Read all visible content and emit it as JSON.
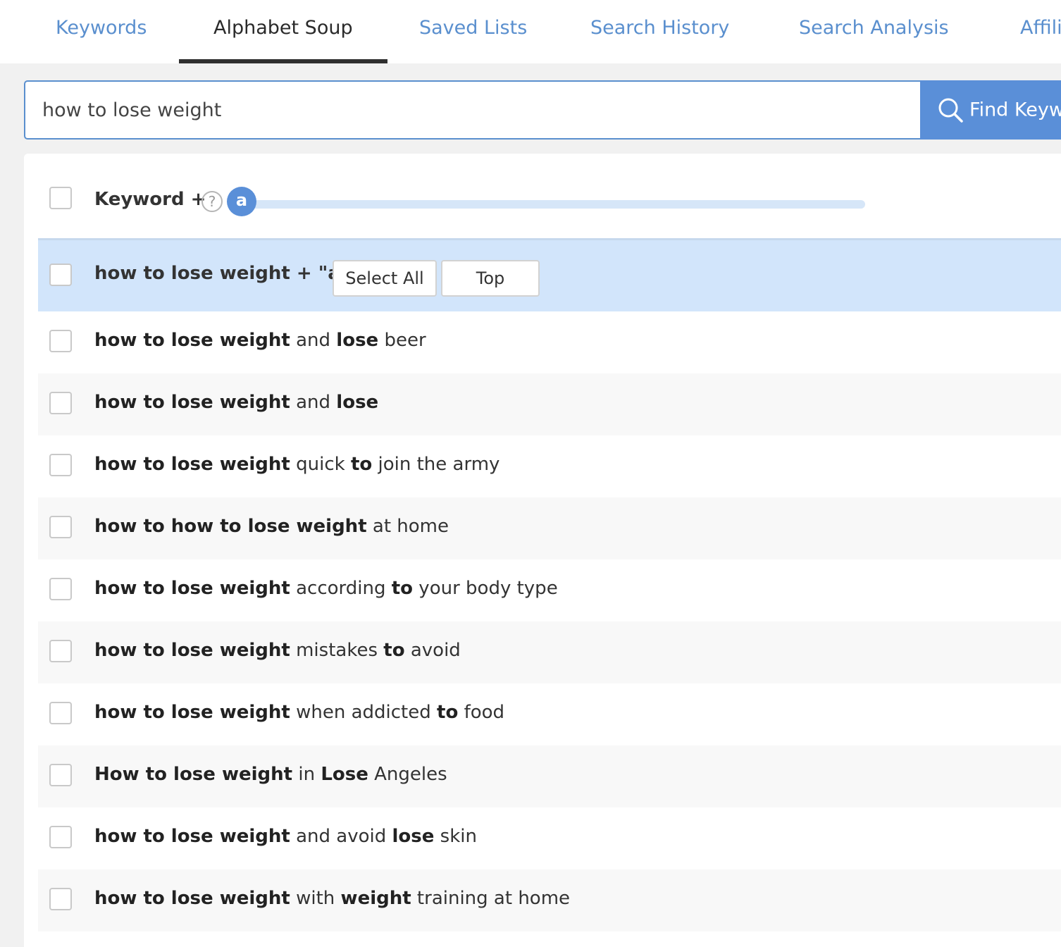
{
  "tabs": [
    {
      "label": "Keywords"
    },
    {
      "label": "Alphabet Soup"
    },
    {
      "label": "Saved Lists"
    },
    {
      "label": "Search History"
    },
    {
      "label": "Search Analysis"
    },
    {
      "label": "Affili"
    }
  ],
  "active_tab": "Alphabet Soup",
  "search": {
    "value": "how to lose weight",
    "button_label": "Find Keyw"
  },
  "header": {
    "keyword_label": "Keyword +",
    "help_glyph": "?",
    "slider_letter": "a"
  },
  "group": {
    "label": "how to lose weight + \"a\"",
    "select_all_label": "Select All",
    "top_label": "Top"
  },
  "results": [
    [
      {
        "t": "how to lose weight",
        "b": true
      },
      {
        "t": " and ",
        "b": false
      },
      {
        "t": "lose",
        "b": true
      },
      {
        "t": " beer",
        "b": false
      }
    ],
    [
      {
        "t": "how to lose weight",
        "b": true
      },
      {
        "t": " and ",
        "b": false
      },
      {
        "t": "lose",
        "b": true
      }
    ],
    [
      {
        "t": "how to lose weight",
        "b": true
      },
      {
        "t": " quick ",
        "b": false
      },
      {
        "t": "to",
        "b": true
      },
      {
        "t": " join the army",
        "b": false
      }
    ],
    [
      {
        "t": "how to how to lose weight",
        "b": true
      },
      {
        "t": " at home",
        "b": false
      }
    ],
    [
      {
        "t": "how to lose weight",
        "b": true
      },
      {
        "t": " according ",
        "b": false
      },
      {
        "t": "to",
        "b": true
      },
      {
        "t": " your body type",
        "b": false
      }
    ],
    [
      {
        "t": "how to lose weight",
        "b": true
      },
      {
        "t": " mistakes ",
        "b": false
      },
      {
        "t": "to",
        "b": true
      },
      {
        "t": " avoid",
        "b": false
      }
    ],
    [
      {
        "t": "how to lose weight",
        "b": true
      },
      {
        "t": " when addicted ",
        "b": false
      },
      {
        "t": "to",
        "b": true
      },
      {
        "t": " food",
        "b": false
      }
    ],
    [
      {
        "t": "How to lose weight",
        "b": true
      },
      {
        "t": " in ",
        "b": false
      },
      {
        "t": "Lose",
        "b": true
      },
      {
        "t": " Angeles",
        "b": false
      }
    ],
    [
      {
        "t": "how to lose weight",
        "b": true
      },
      {
        "t": " and avoid ",
        "b": false
      },
      {
        "t": "lose",
        "b": true
      },
      {
        "t": " skin",
        "b": false
      }
    ],
    [
      {
        "t": "how to lose weight",
        "b": true
      },
      {
        "t": " with ",
        "b": false
      },
      {
        "t": "weight",
        "b": true
      },
      {
        "t": " training at home",
        "b": false
      }
    ]
  ],
  "colors": {
    "accent": "#5a8fd8",
    "tab_link": "#5a8fce",
    "selected_row": "#d2e5fb"
  }
}
